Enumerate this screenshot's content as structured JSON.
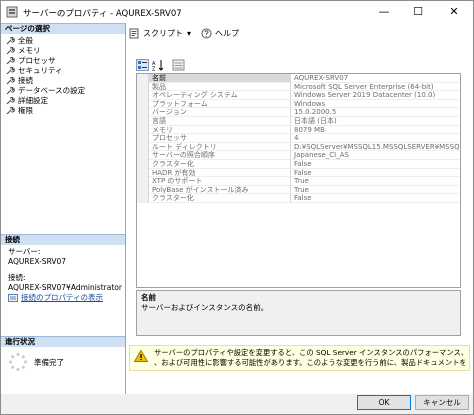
{
  "window": {
    "title": "サーバーのプロパティ - AQUREX-SRV07",
    "minimize_glyph": "—",
    "maximize_glyph": "☐",
    "close_glyph": "✕"
  },
  "sidebar": {
    "pages_header": "ページの選択",
    "items": [
      {
        "label": "全般",
        "icon": "wrench-icon"
      },
      {
        "label": "メモリ",
        "icon": "wrench-icon"
      },
      {
        "label": "プロセッサ",
        "icon": "wrench-icon"
      },
      {
        "label": "セキュリティ",
        "icon": "wrench-icon"
      },
      {
        "label": "接続",
        "icon": "wrench-icon"
      },
      {
        "label": "データベースの設定",
        "icon": "wrench-icon"
      },
      {
        "label": "詳細設定",
        "icon": "wrench-icon"
      },
      {
        "label": "権限",
        "icon": "wrench-icon"
      }
    ],
    "connection_header": "接続",
    "server_label": "サーバー:",
    "server_value": "AQUREX-SRV07",
    "connection_label": "接続:",
    "connection_value": "AQUREX-SRV07¥Administrator",
    "view_props_link": "接続のプロパティの表示",
    "progress_header": "進行状況",
    "progress_status": "準備完了"
  },
  "toolbar": {
    "script_label": "スクリプト",
    "script_dropdown_glyph": "▾",
    "help_label": "ヘルプ"
  },
  "grid": {
    "rows": [
      {
        "name": "名前",
        "value": "AQUREX-SRV07"
      },
      {
        "name": "製品",
        "value": "Microsoft SQL Server Enterprise (64-bit)"
      },
      {
        "name": "オペレーティング システム",
        "value": "Windows Server 2019 Datacenter (10.0)"
      },
      {
        "name": "プラットフォーム",
        "value": "Windows"
      },
      {
        "name": "バージョン",
        "value": "15.0.2000.5"
      },
      {
        "name": "言語",
        "value": "日本語 (日本)"
      },
      {
        "name": "メモリ",
        "value": "8079 MB"
      },
      {
        "name": "プロセッサ",
        "value": "4"
      },
      {
        "name": "ルート ディレクトリ",
        "value": "D:¥SQLServer¥MSSQL15.MSSQLSERVER¥MSSQ"
      },
      {
        "name": "サーバーの照合順序",
        "value": "Japanese_CI_AS"
      },
      {
        "name": "クラスター化",
        "value": "False"
      },
      {
        "name": "HADR が有効",
        "value": "False"
      },
      {
        "name": "XTP のサポート",
        "value": "True"
      },
      {
        "name": "PolyBase がインストール済み",
        "value": "True"
      },
      {
        "name": "クラスター化",
        "value": "False"
      }
    ],
    "selected_index": 0
  },
  "description": {
    "title": "名前",
    "text": "サーバーおよびインスタンスの名前。"
  },
  "warning": {
    "line1": "サーバーのプロパティや設定を変更すると、この SQL Server インスタンスのパフォーマンス、セキュリティ",
    "line2": "、および可用性に影響する可能性があります。このような変更を行う前に、製品ドキュメントを参"
  },
  "buttons": {
    "ok": "OK",
    "cancel": "キャンセル"
  },
  "colors": {
    "section_header_bg": "#cfe0f5",
    "link": "#1a4da2",
    "warning_bg": "#ffffe1",
    "ok_border": "#0078d7"
  }
}
